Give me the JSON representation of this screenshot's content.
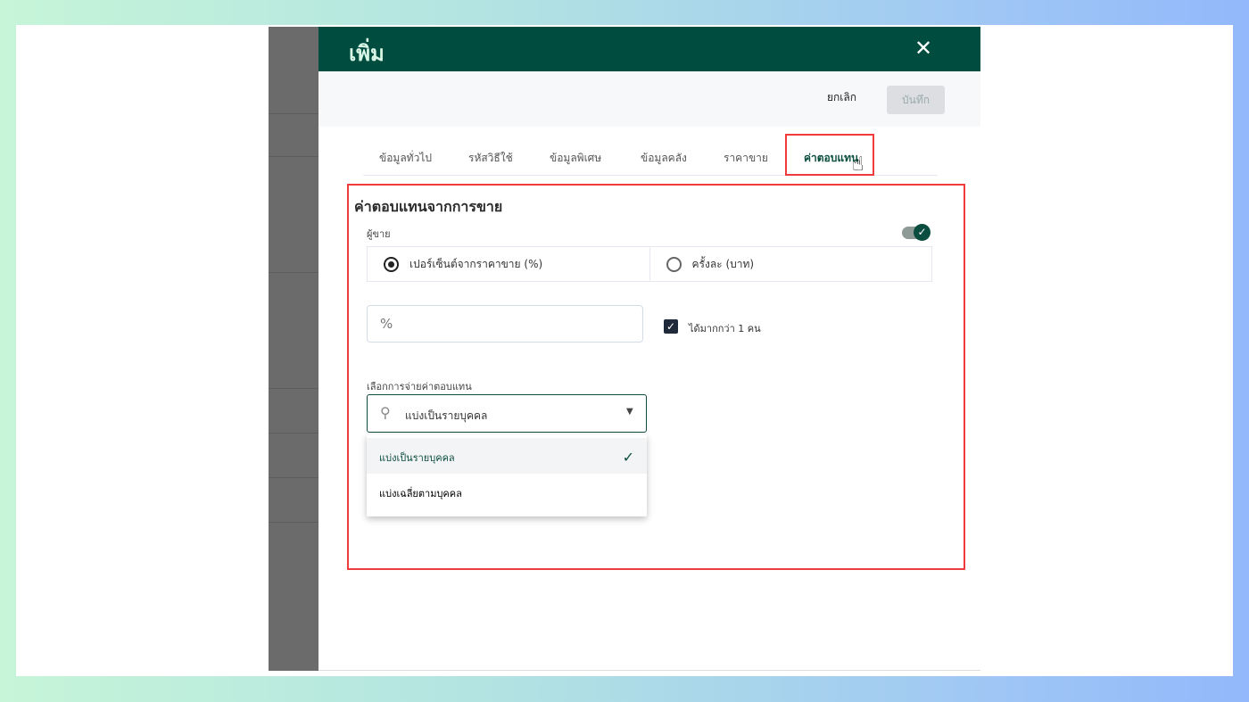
{
  "dialog": {
    "title": "เพิ่ม",
    "close_icon": "close-icon"
  },
  "toolbar": {
    "cancel_label": "ยกเลิก",
    "save_label": "บันทึก"
  },
  "tabs": [
    {
      "label": "ข้อมูลทั่วไป"
    },
    {
      "label": "รหัสวิธีใช้"
    },
    {
      "label": "ข้อมูลพิเศษ"
    },
    {
      "label": "ข้อมูลคลัง"
    },
    {
      "label": "ราคาขาย"
    },
    {
      "label": "ค่าตอบแทน",
      "active": true
    }
  ],
  "section": {
    "title": "ค่าตอบแทนจากการขาย",
    "seller_label": "ผู้ขาย",
    "seller_enabled": true,
    "radios": [
      {
        "label": "เปอร์เซ็นต์จากราคาขาย (%)",
        "selected": true
      },
      {
        "label": "ครั้งละ (บาท)",
        "selected": false
      }
    ],
    "percent_placeholder": "%",
    "multi_checkbox_label": "ได้มากกว่า 1 คน",
    "multi_checked": true,
    "select_label": "เลือกการจ่ายค่าตอบแทน",
    "select_value": "แบ่งเป็นรายบุคคล",
    "options": [
      {
        "label": "แบ่งเป็นรายบุคคล",
        "selected": true
      },
      {
        "label": "แบ่งเฉลี่ยตามบุคคล"
      }
    ]
  },
  "colors": {
    "header": "#004d40",
    "accent": "#0b4d3e",
    "highlight": "#ef3b3b"
  }
}
